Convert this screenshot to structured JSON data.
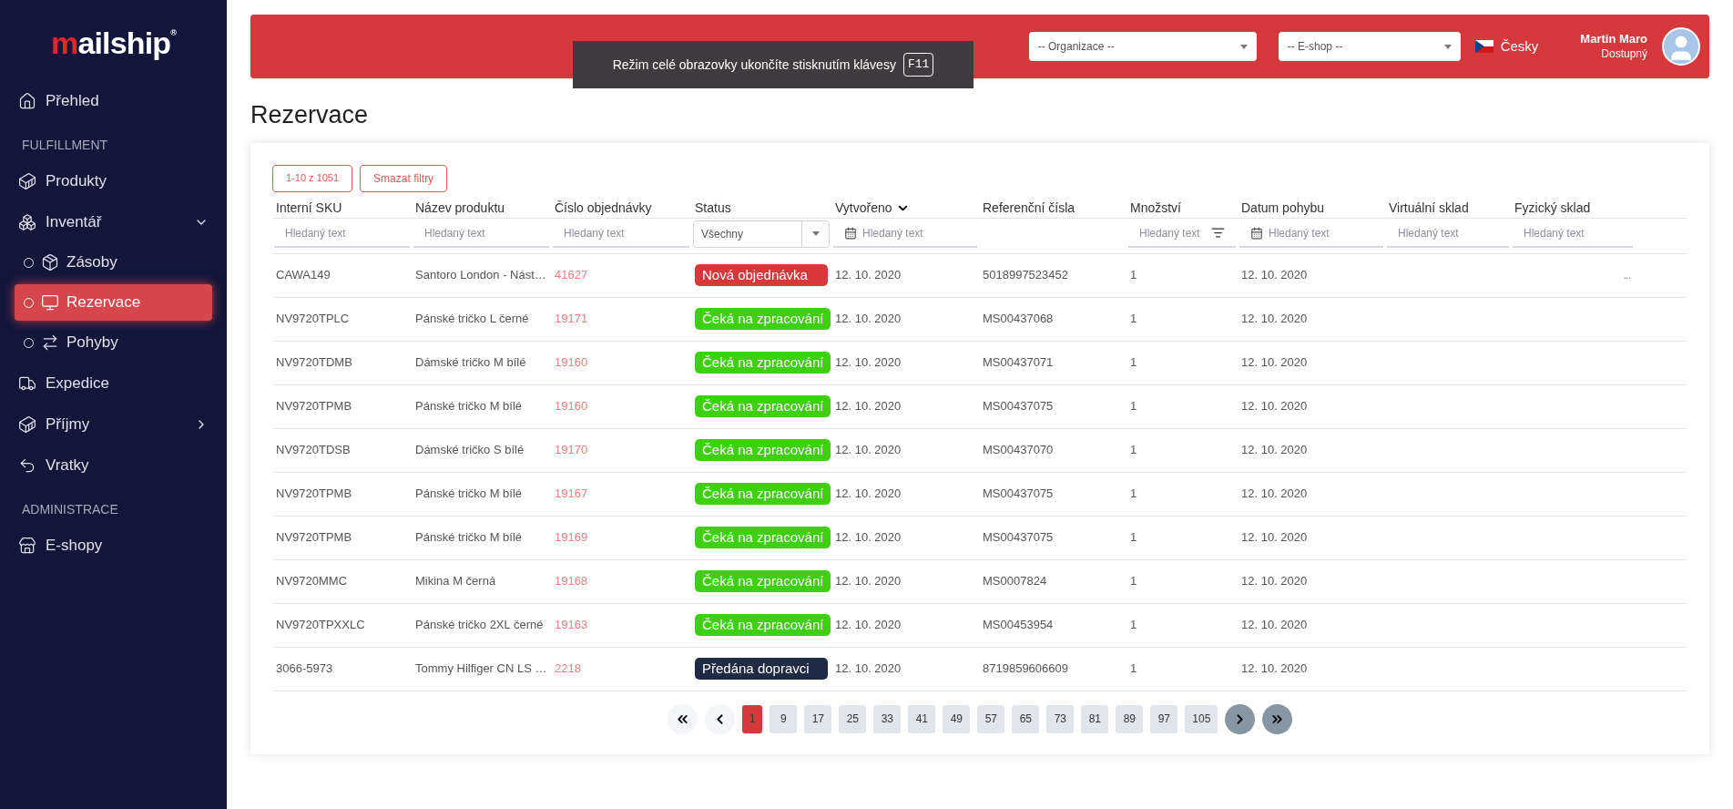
{
  "logo": {
    "accent": "m",
    "rest": "ailship",
    "mark": "®"
  },
  "sidebar": {
    "items": [
      {
        "kind": "item",
        "label": "Přehled"
      },
      {
        "kind": "section",
        "label": "FULFILLMENT"
      },
      {
        "kind": "item",
        "label": "Produkty"
      },
      {
        "kind": "item",
        "label": "Inventář",
        "expanded": true,
        "children": [
          {
            "label": "Zásoby",
            "selected": false
          },
          {
            "label": "Rezervace",
            "selected": true
          },
          {
            "label": "Pohyby",
            "selected": false
          }
        ]
      },
      {
        "kind": "item",
        "label": "Expedice"
      },
      {
        "kind": "item",
        "label": "Příjmy",
        "expanded": false
      },
      {
        "kind": "item",
        "label": "Vratky"
      },
      {
        "kind": "section",
        "label": "ADMINISTRACE"
      },
      {
        "kind": "item",
        "label": "E-shopy"
      }
    ]
  },
  "header": {
    "organization": {
      "placeholder": "-- Organizace --"
    },
    "eshop": {
      "placeholder": "-- E-shop --"
    },
    "language": "Česky",
    "user": {
      "name": "Martin Maro",
      "status": "Dostupný"
    }
  },
  "toast": {
    "text": "Režim celé obrazovky ukončíte stisknutím klávesy",
    "key": "F11"
  },
  "page_title": "Rezervace",
  "toolbar": {
    "range": "1-10 z 1051",
    "clear": "Smazat filtry"
  },
  "table": {
    "columns": [
      {
        "label": "Interní SKU",
        "filter": {
          "kind": "text",
          "placeholder": "Hledaný text"
        }
      },
      {
        "label": "Název produktu",
        "filter": {
          "kind": "text",
          "placeholder": "Hledaný text"
        }
      },
      {
        "label": "Číslo objednávky",
        "filter": {
          "kind": "text",
          "placeholder": "Hledaný text"
        }
      },
      {
        "label": "Status",
        "filter": {
          "kind": "select",
          "value": "Všechny"
        }
      },
      {
        "label": "Vytvořeno",
        "sorted": true,
        "filter": {
          "kind": "date",
          "placeholder": "Hledaný text"
        }
      },
      {
        "label": "Referenční čísla",
        "filter": {
          "kind": "none"
        }
      },
      {
        "label": "Množství",
        "filter": {
          "kind": "funnel",
          "placeholder": "Hledaný text"
        }
      },
      {
        "label": "Datum pohybu",
        "filter": {
          "kind": "date",
          "placeholder": "Hledaný text"
        }
      },
      {
        "label": "Virtuální sklad",
        "filter": {
          "kind": "text",
          "placeholder": "Hledaný text"
        }
      },
      {
        "label": "Fyzický sklad",
        "filter": {
          "kind": "text",
          "placeholder": "Hledaný text"
        }
      }
    ],
    "rows": [
      {
        "sku": "CAWA149",
        "name": "Santoro London - Nást…",
        "order": "41627",
        "status": {
          "label": "Nová objednávka",
          "color": "#d9383b"
        },
        "created": "12. 10. 2020",
        "ref": "5018997523452",
        "qty": "1",
        "moved": "12. 10. 2020",
        "physical": "..."
      },
      {
        "sku": "NV9720TPLC",
        "name": "Pánské tričko L černé",
        "order": "19171",
        "status": {
          "label": "Čeká na zpracování",
          "color": "#3ecf0e"
        },
        "created": "12. 10. 2020",
        "ref": "MS00437068",
        "qty": "1",
        "moved": "12. 10. 2020"
      },
      {
        "sku": "NV9720TDMB",
        "name": "Dámské tričko M bílé",
        "order": "19160",
        "status": {
          "label": "Čeká na zpracování",
          "color": "#3ecf0e"
        },
        "created": "12. 10. 2020",
        "ref": "MS00437071",
        "qty": "1",
        "moved": "12. 10. 2020"
      },
      {
        "sku": "NV9720TPMB",
        "name": "Pánské tričko M bílé",
        "order": "19160",
        "status": {
          "label": "Čeká na zpracování",
          "color": "#3ecf0e"
        },
        "created": "12. 10. 2020",
        "ref": "MS00437075",
        "qty": "1",
        "moved": "12. 10. 2020"
      },
      {
        "sku": "NV9720TDSB",
        "name": "Dámské tričko S bílé",
        "order": "19170",
        "status": {
          "label": "Čeká na zpracování",
          "color": "#3ecf0e"
        },
        "created": "12. 10. 2020",
        "ref": "MS00437070",
        "qty": "1",
        "moved": "12. 10. 2020"
      },
      {
        "sku": "NV9720TPMB",
        "name": "Pánské tričko M bílé",
        "order": "19167",
        "status": {
          "label": "Čeká na zpracování",
          "color": "#3ecf0e"
        },
        "created": "12. 10. 2020",
        "ref": "MS00437075",
        "qty": "1",
        "moved": "12. 10. 2020"
      },
      {
        "sku": "NV9720TPMB",
        "name": "Pánské tričko M bílé",
        "order": "19169",
        "status": {
          "label": "Čeká na zpracování",
          "color": "#3ecf0e"
        },
        "created": "12. 10. 2020",
        "ref": "MS00437075",
        "qty": "1",
        "moved": "12. 10. 2020"
      },
      {
        "sku": "NV9720MMC",
        "name": "Mikina M černá",
        "order": "19168",
        "status": {
          "label": "Čeká na zpracování",
          "color": "#3ecf0e"
        },
        "created": "12. 10. 2020",
        "ref": "MS0007824",
        "qty": "1",
        "moved": "12. 10. 2020"
      },
      {
        "sku": "NV9720TPXXLC",
        "name": "Pánské tričko 2XL černé",
        "order": "19163",
        "status": {
          "label": "Čeká na zpracování",
          "color": "#3ecf0e"
        },
        "created": "12. 10. 2020",
        "ref": "MS00453954",
        "qty": "1",
        "moved": "12. 10. 2020"
      },
      {
        "sku": "3066-5973",
        "name": "Tommy Hilfiger CN LS …",
        "order": "2218",
        "status": {
          "label": "Předána dopravci",
          "color": "#1f2a44"
        },
        "created": "12. 10. 2020",
        "ref": "8719859606609",
        "qty": "1",
        "moved": "12. 10. 2020"
      }
    ]
  },
  "pagination": {
    "first": {
      "disabled": true
    },
    "prev": {
      "disabled": true
    },
    "pages": [
      {
        "label": "1",
        "selected": true
      },
      {
        "label": "9",
        "selected": false
      },
      {
        "label": "17",
        "selected": false
      },
      {
        "label": "25",
        "selected": false
      },
      {
        "label": "33",
        "selected": false
      },
      {
        "label": "41",
        "selected": false
      },
      {
        "label": "49",
        "selected": false
      },
      {
        "label": "57",
        "selected": false
      },
      {
        "label": "65",
        "selected": false
      },
      {
        "label": "73",
        "selected": false
      },
      {
        "label": "81",
        "selected": false
      },
      {
        "label": "89",
        "selected": false
      },
      {
        "label": "97",
        "selected": false
      },
      {
        "label": "105",
        "selected": false
      }
    ],
    "next": {
      "disabled": false
    },
    "last": {
      "disabled": false
    }
  }
}
